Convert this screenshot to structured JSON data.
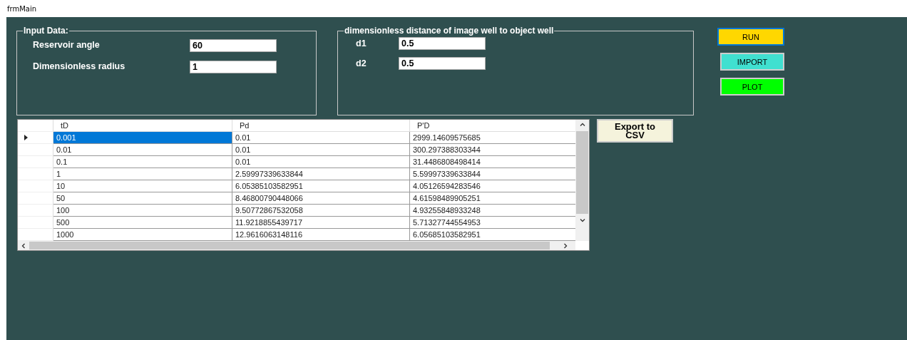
{
  "window": {
    "title": "frmMain"
  },
  "input_group": {
    "title": "Input Data:",
    "fields": [
      {
        "label": "Reservoir angle",
        "value": "60"
      },
      {
        "label": "Dimensionless radius",
        "value": "1"
      }
    ]
  },
  "distance_group": {
    "title": "dimensionless distance of  image well to object well",
    "fields": [
      {
        "label": "d1",
        "value": "0.5"
      },
      {
        "label": "d2",
        "value": "0.5"
      }
    ]
  },
  "buttons": [
    {
      "label": "RUN",
      "color": "#ffd700",
      "focused": true
    },
    {
      "label": "IMPORT",
      "color": "#40e0d0",
      "focused": false
    },
    {
      "label": "PLOT",
      "color": "#00ff00",
      "focused": false
    }
  ],
  "table": {
    "columns": [
      "tD",
      "Pd",
      "P'D"
    ],
    "rows": [
      {
        "cells": [
          "0.001",
          "0.01",
          "2999.14609575685"
        ],
        "selected": true
      },
      {
        "cells": [
          "0.01",
          "0.01",
          "300.297388303344"
        ],
        "selected": false
      },
      {
        "cells": [
          "0.1",
          "0.01",
          "31.4486808498414"
        ],
        "selected": false
      },
      {
        "cells": [
          "1",
          "2.59997339633844",
          "5.59997339633844"
        ],
        "selected": false
      },
      {
        "cells": [
          "10",
          "6.05385103582951",
          "4.05126594283546"
        ],
        "selected": false
      },
      {
        "cells": [
          "50",
          "8.46800790448066",
          "4.61598489905251"
        ],
        "selected": false
      },
      {
        "cells": [
          "100",
          "9.50772867532058",
          "4.93255848933248"
        ],
        "selected": false
      },
      {
        "cells": [
          "500",
          "11.9218855439717",
          "5.71327744554953"
        ],
        "selected": false
      },
      {
        "cells": [
          "1000",
          "12.9616063148116",
          "6.05685103582951"
        ],
        "selected": false
      }
    ]
  },
  "export_button": {
    "label": "Export to CSV"
  }
}
